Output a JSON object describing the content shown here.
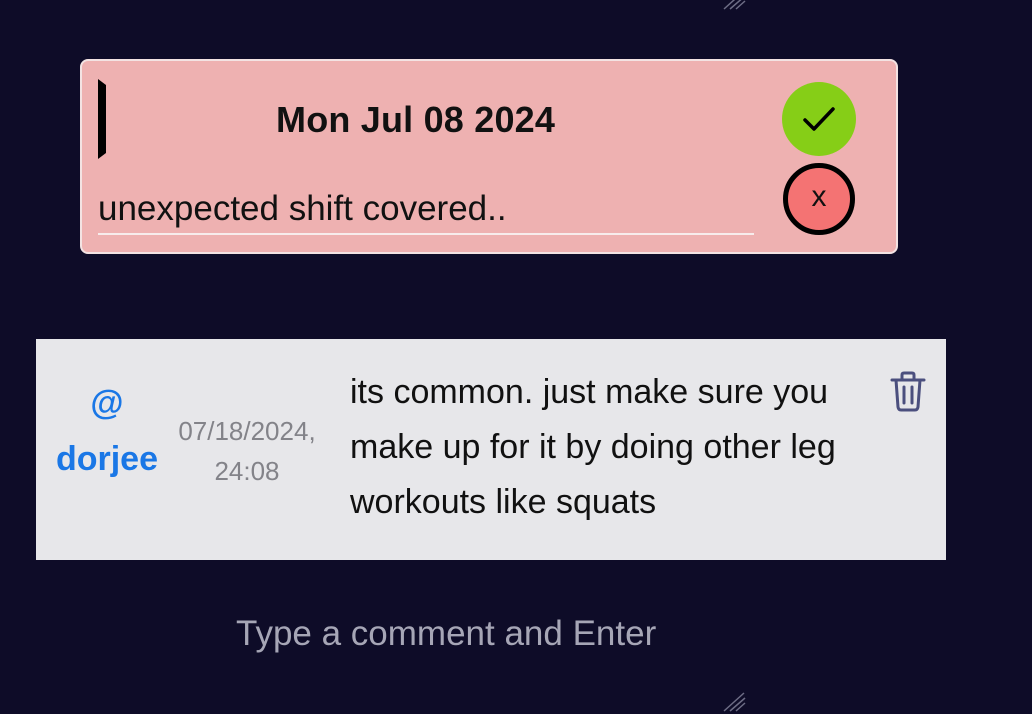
{
  "entry": {
    "date": "Mon Jul 08 2024",
    "note_value": "unexpected shift covered..",
    "cancel_label": "x",
    "colors": {
      "card_bg": "#eeb1b1",
      "confirm": "#86ce17",
      "cancel": "#f47373"
    }
  },
  "comment": {
    "user": "@ dorjee",
    "timestamp": "07/18/2024, 24:08",
    "text": "its common. just make sure you make up for it by doing other leg workouts like squats",
    "delete_icon": "trash-icon"
  },
  "comment_input": {
    "placeholder": "Type a comment and Enter"
  }
}
